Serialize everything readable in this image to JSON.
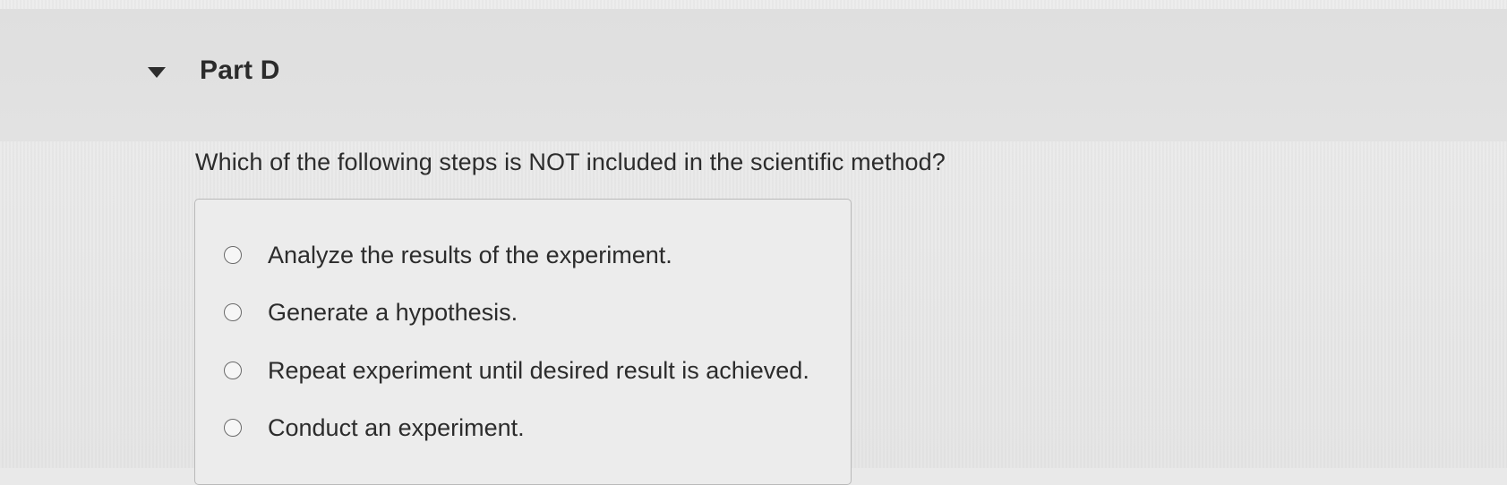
{
  "part": {
    "title": "Part D",
    "expanded": true
  },
  "question": {
    "text": "Which of the following steps is NOT included in the scientific method?"
  },
  "options": [
    {
      "label": "Analyze the results of the experiment.",
      "selected": false
    },
    {
      "label": "Generate a hypothesis.",
      "selected": false
    },
    {
      "label": "Repeat experiment until desired result is achieved.",
      "selected": false
    },
    {
      "label": "Conduct an experiment.",
      "selected": false
    }
  ],
  "icons": {
    "toggle": "caret-down-icon",
    "option_marker": "radio-unselected-icon"
  },
  "colors": {
    "background": "#e9e9e9",
    "header_band": "#dfdfdf",
    "text": "#2a2a2a",
    "box_border": "#b9b9b9"
  }
}
